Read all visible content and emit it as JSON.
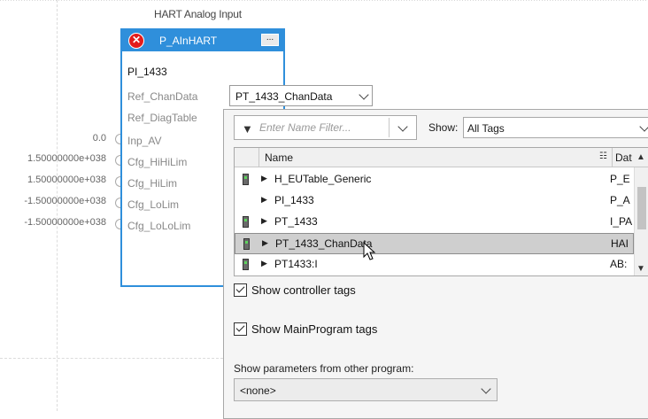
{
  "block": {
    "title": "HART Analog Input",
    "name": "P_AInHART",
    "ellipsis": "...",
    "tag": "PI_1433",
    "params": [
      "Ref_ChanData",
      "Ref_DiagTable",
      "Inp_AV",
      "Cfg_HiHiLim",
      "Cfg_HiLim",
      "Cfg_LoLim",
      "Cfg_LoLoLim"
    ],
    "pin_values": [
      "0.0",
      "1.50000000e+038",
      "1.50000000e+038",
      "-1.50000000e+038",
      "-1.50000000e+038"
    ],
    "error_icon": "error-x-icon"
  },
  "ref_dropdown": {
    "value": "PT_1433_ChanData"
  },
  "browser": {
    "filter_placeholder": "Enter Name Filter...",
    "show_label": "Show:",
    "show_value": "All Tags",
    "columns": {
      "name": "Name",
      "type": "Dat"
    },
    "rows": [
      {
        "name": "H_EUTable_Generic",
        "type": "P_E",
        "has_device": true,
        "selected": false
      },
      {
        "name": "PI_1433",
        "type": "P_A",
        "has_device": false,
        "selected": false
      },
      {
        "name": "PT_1433",
        "type": "I_PA",
        "has_device": true,
        "selected": false
      },
      {
        "name": "PT_1433_ChanData",
        "type": "HAI",
        "has_device": true,
        "selected": true
      },
      {
        "name": "PT1433:I",
        "type": "AB:",
        "has_device": true,
        "selected": false
      }
    ],
    "show_controller_tags": {
      "label": "Show controller tags",
      "checked": true
    },
    "show_mainprogram_tags": {
      "label": "Show MainProgram tags",
      "checked": true
    },
    "other_program_label": "Show parameters from other program:",
    "other_program_value": "<none>"
  }
}
